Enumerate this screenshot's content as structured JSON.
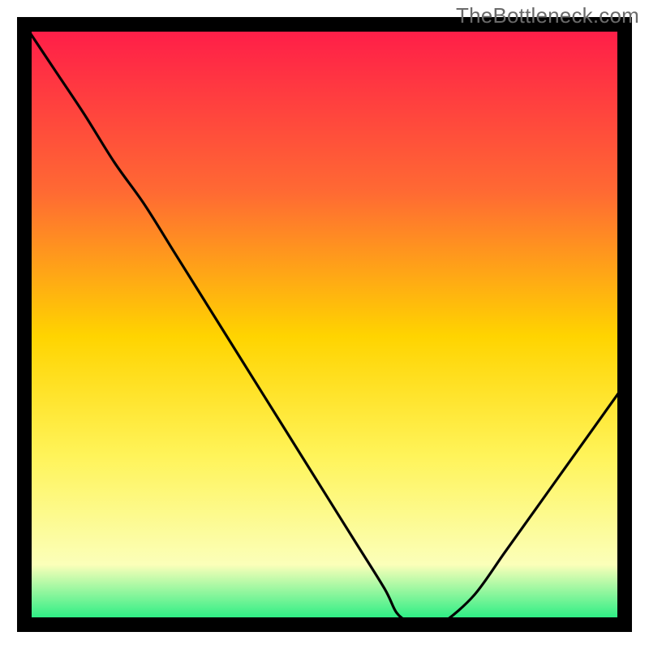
{
  "watermark": "TheBottleneck.com",
  "chart_data": {
    "type": "line",
    "title": "",
    "xlabel": "",
    "ylabel": "",
    "xlim": [
      0,
      100
    ],
    "ylim": [
      0,
      100
    ],
    "x": [
      0,
      5,
      10,
      15,
      20,
      25,
      30,
      35,
      40,
      45,
      50,
      55,
      60,
      62,
      64,
      66,
      68,
      70,
      75,
      80,
      85,
      90,
      95,
      100
    ],
    "values": [
      100,
      92.5,
      85,
      77,
      70,
      62,
      54,
      46,
      38,
      30,
      22,
      14,
      6,
      2,
      0.5,
      0,
      0,
      0.5,
      5,
      12,
      19,
      26,
      33,
      40
    ],
    "marker": {
      "x": 66,
      "y": 0,
      "color": "#d76a6a"
    },
    "gradient_colors": {
      "top": "#ff1b49",
      "upper_mid": "#ff8f2f",
      "mid": "#ffd400",
      "lower_mid": "#fff45a",
      "near_bottom": "#fbffb9",
      "bottom": "#13ec7e"
    },
    "frame_color": "#000000",
    "curve_color": "#000000"
  }
}
